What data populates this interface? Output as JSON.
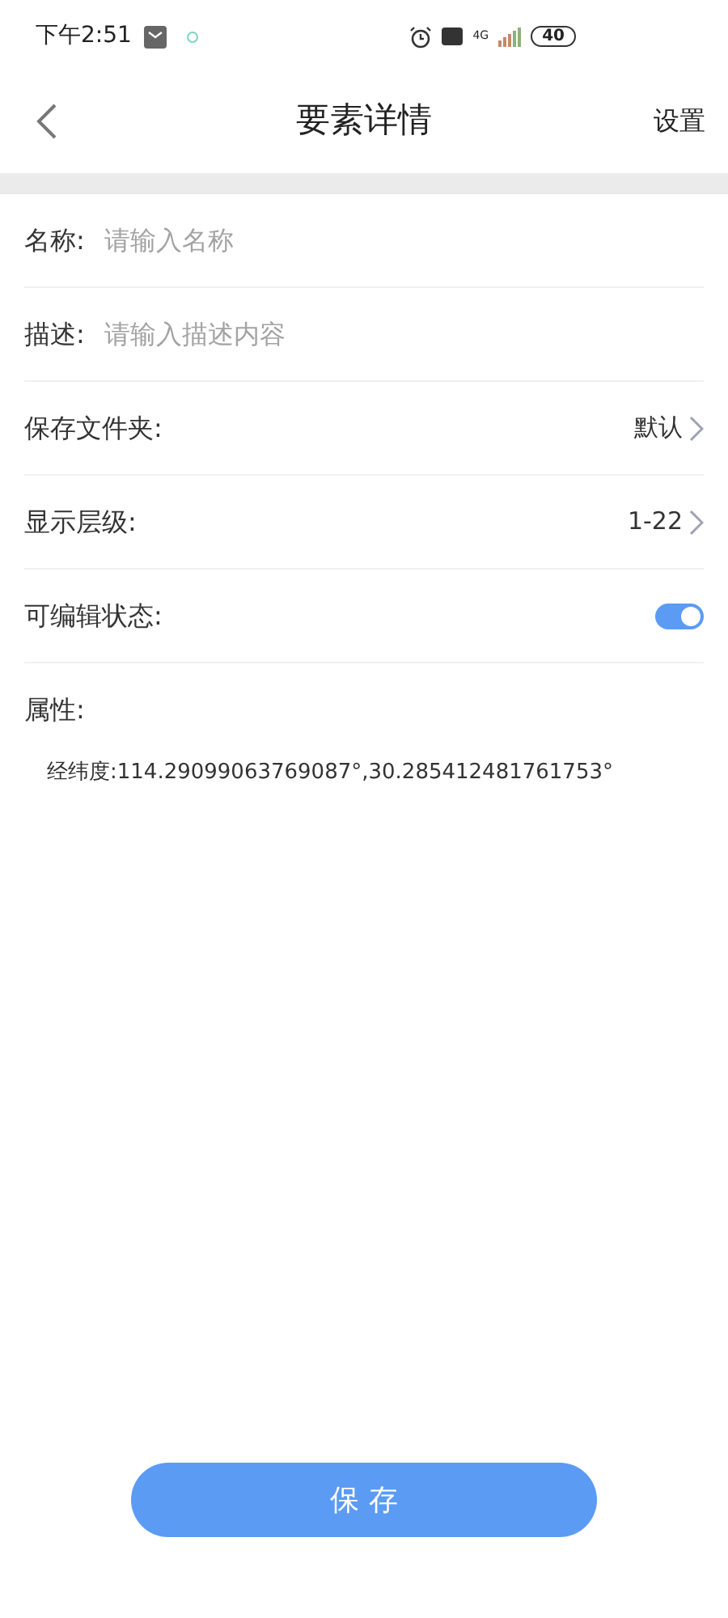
{
  "status_bar": {
    "time": "下午2:51",
    "network": "4G",
    "battery": "40"
  },
  "header": {
    "title": "要素详情",
    "action": "设置"
  },
  "fields": [
    {
      "kind": "input",
      "label": "名称:",
      "placeholder": "请输入名称"
    },
    {
      "kind": "input",
      "label": "描述:",
      "placeholder": "请输入描述内容"
    },
    {
      "kind": "select",
      "label": "保存文件夹:",
      "value": "默认"
    },
    {
      "kind": "select",
      "label": "显示层级:",
      "value": "1-22"
    },
    {
      "kind": "toggle",
      "label": "可编辑状态:",
      "on": true
    }
  ],
  "attributes": {
    "label": "属性:",
    "items": [
      "经纬度:114.29099063769087°,30.285412481761753°"
    ]
  },
  "save_button": "保 存"
}
